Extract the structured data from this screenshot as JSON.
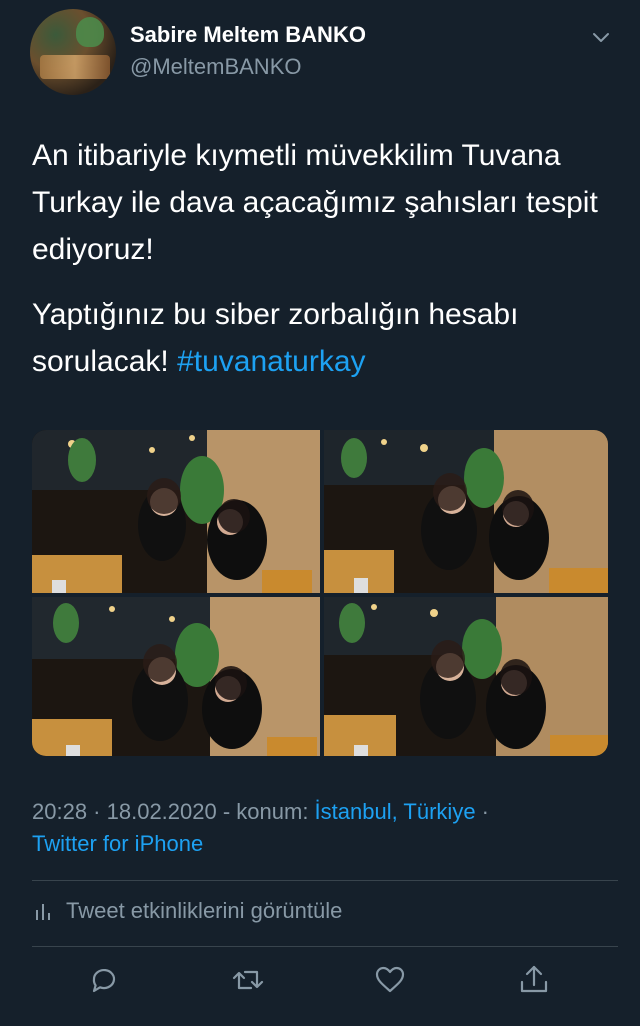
{
  "author": {
    "display_name": "Sabire Meltem BANKO",
    "handle": "@MeltemBANKO"
  },
  "tweet": {
    "paragraph_1": "An itibariyle kıymetli müvekkilim Tuvana Turkay ile dava açacağımız şahısları tespit ediyoruz!",
    "paragraph_2_text": "Yaptığınız bu siber zorbalığın hesabı sorulacak! ",
    "hashtag": "#tuvanaturkay"
  },
  "meta": {
    "time": "20:28",
    "separator": " · ",
    "date": "18.02.2020",
    "location_prefix": " - konum: ",
    "location": "İstanbul, Türkiye",
    "trailing_dot": " ·",
    "client": "Twitter for iPhone"
  },
  "activity": {
    "label": "Tweet etkinliklerini görüntüle"
  },
  "icons": {
    "reply": "reply-icon",
    "retweet": "retweet-icon",
    "like": "heart-icon",
    "share": "share-icon",
    "activity": "bar-chart-icon",
    "more": "chevron-down-icon"
  },
  "colors": {
    "background": "#15202b",
    "text": "#ffffff",
    "secondary": "#8899a6",
    "accent": "#1da1f2",
    "divider": "#38444d"
  }
}
